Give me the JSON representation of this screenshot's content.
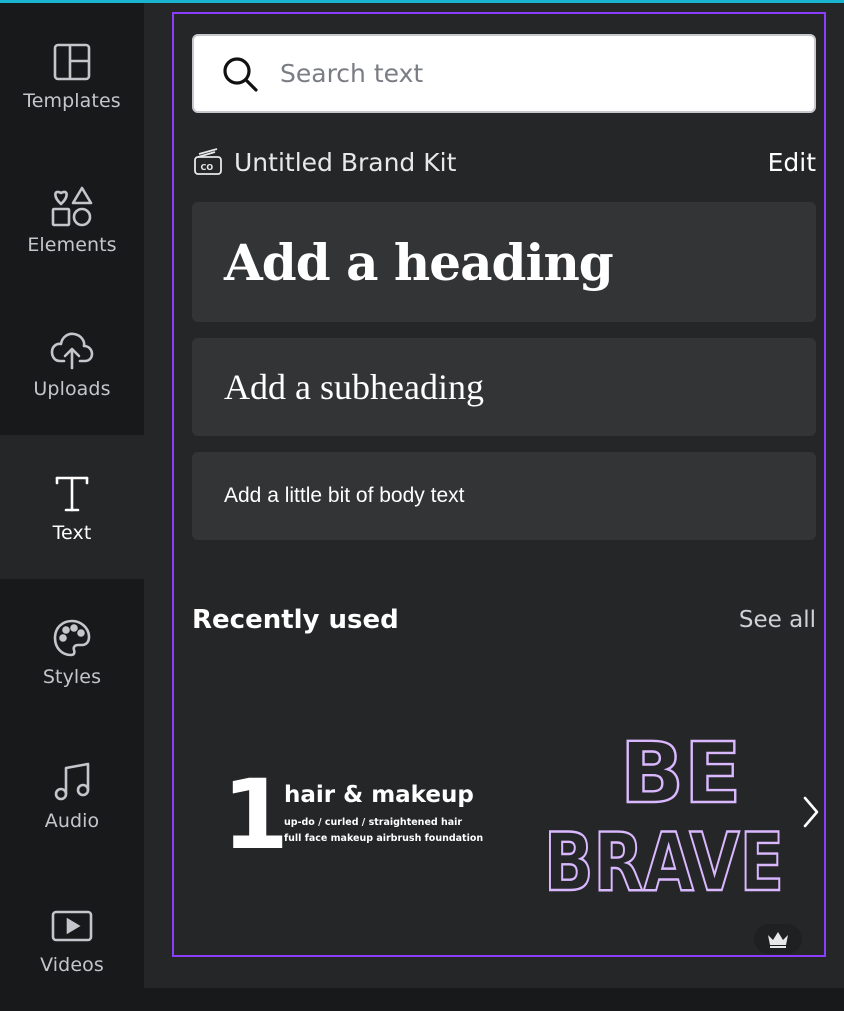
{
  "sidebar": {
    "items": [
      {
        "label": "Templates",
        "icon": "templates-icon"
      },
      {
        "label": "Elements",
        "icon": "elements-icon"
      },
      {
        "label": "Uploads",
        "icon": "upload-cloud-icon"
      },
      {
        "label": "Text",
        "icon": "text-icon",
        "active": true
      },
      {
        "label": "Styles",
        "icon": "palette-icon"
      },
      {
        "label": "Audio",
        "icon": "music-note-icon"
      },
      {
        "label": "Videos",
        "icon": "video-play-icon"
      }
    ]
  },
  "search": {
    "placeholder": "Search text"
  },
  "brand_kit": {
    "title": "Untitled Brand Kit",
    "badge": "CO",
    "edit_label": "Edit"
  },
  "text_styles": {
    "heading": "Add a heading",
    "subheading": "Add a subheading",
    "body": "Add a little bit of body text"
  },
  "recently_used": {
    "title": "Recently used",
    "see_all_label": "See all",
    "items": [
      {
        "number": "1",
        "title": "hair & makeup",
        "line1": "up-do / curled / straightened hair",
        "line2": "full face makeup  airbrush foundation"
      },
      {
        "line1": "BE",
        "line2": "BRAVE",
        "premium": true
      }
    ]
  },
  "colors": {
    "accent_outline": "#8b3dff",
    "top_accent": "#19b4d2",
    "panel_bg": "#252627",
    "sidebar_bg": "#18191b",
    "card_bg": "#333436",
    "brave_outline": "#d9b8ff"
  }
}
